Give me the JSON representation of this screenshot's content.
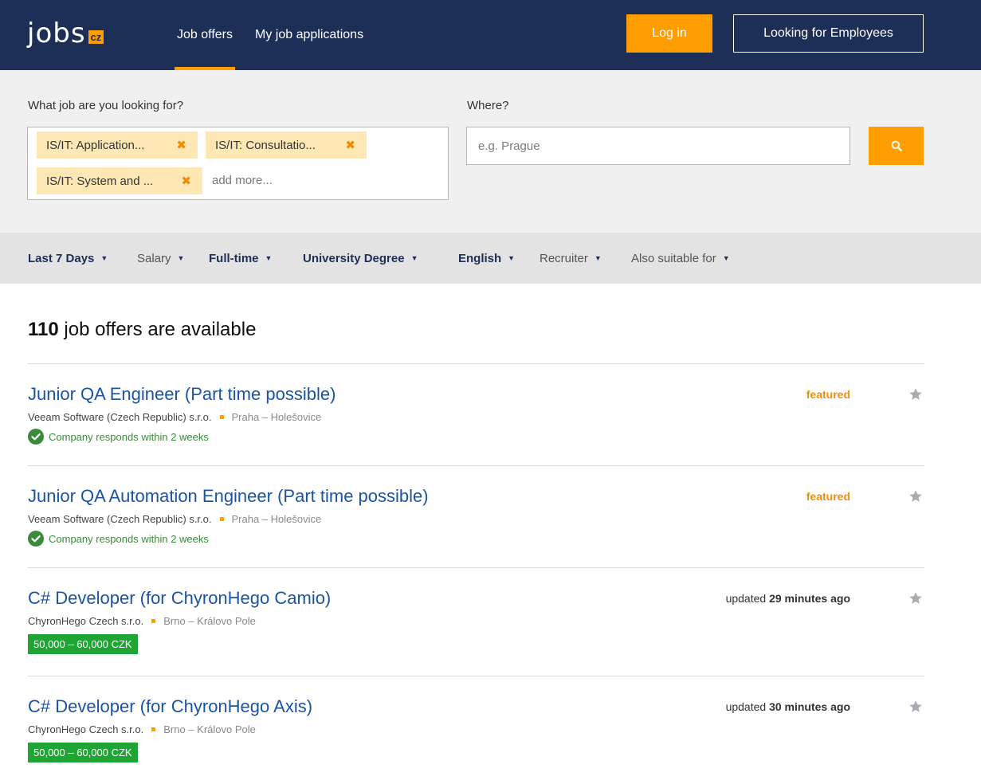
{
  "header": {
    "logo_text": "jobs",
    "logo_badge": "cz",
    "nav": {
      "job_offers": "Job offers",
      "my_applications": "My job applications"
    },
    "login_label": "Log in",
    "employers_label": "Looking for Employees",
    "colors": {
      "bar": "#1d2f56",
      "accent": "#ff9e00"
    }
  },
  "search": {
    "what_label": "What job are you looking for?",
    "tags": [
      "IS/IT: Application...",
      "IS/IT: Consultatio...",
      "IS/IT: System and ..."
    ],
    "add_more": "add more...",
    "where_label": "Where?",
    "where_placeholder": "e.g. Prague",
    "search_icon": "search-icon"
  },
  "filters": [
    {
      "label": "Last 7 Days",
      "active": true
    },
    {
      "label": "Salary",
      "active": false
    },
    {
      "label": "Full-time",
      "active": true
    },
    {
      "label": "University Degree",
      "active": true
    },
    {
      "label": "English",
      "active": true
    },
    {
      "label": "Recruiter",
      "active": false
    },
    {
      "label": "Also suitable for",
      "active": false
    }
  ],
  "results": {
    "count": "110",
    "count_suffix": "job offers are available"
  },
  "jobs": [
    {
      "title": "Junior QA Engineer (Part time possible)",
      "company": "Veeam Software (Czech Republic) s.r.o.",
      "location": "Praha – Holešovice",
      "responds": "Company responds within 2 weeks",
      "status": "featured"
    },
    {
      "title": "Junior QA Automation Engineer (Part time possible)",
      "company": "Veeam Software (Czech Republic) s.r.o.",
      "location": "Praha – Holešovice",
      "responds": "Company responds within 2 weeks",
      "status": "featured"
    },
    {
      "title": "C# Developer (for ChyronHego Camio)",
      "company": "ChyronHego Czech s.r.o.",
      "location": "Brno – Královo Pole",
      "salary": "50,000 – 60,000 CZK",
      "updated_prefix": "updated",
      "updated_time": "29 minutes ago"
    },
    {
      "title": "C# Developer (for ChyronHego Axis)",
      "company": "ChyronHego Czech s.r.o.",
      "location": "Brno – Královo Pole",
      "salary": "50,000 – 60,000 CZK",
      "updated_prefix": "updated",
      "updated_time": "30 minutes ago"
    }
  ]
}
